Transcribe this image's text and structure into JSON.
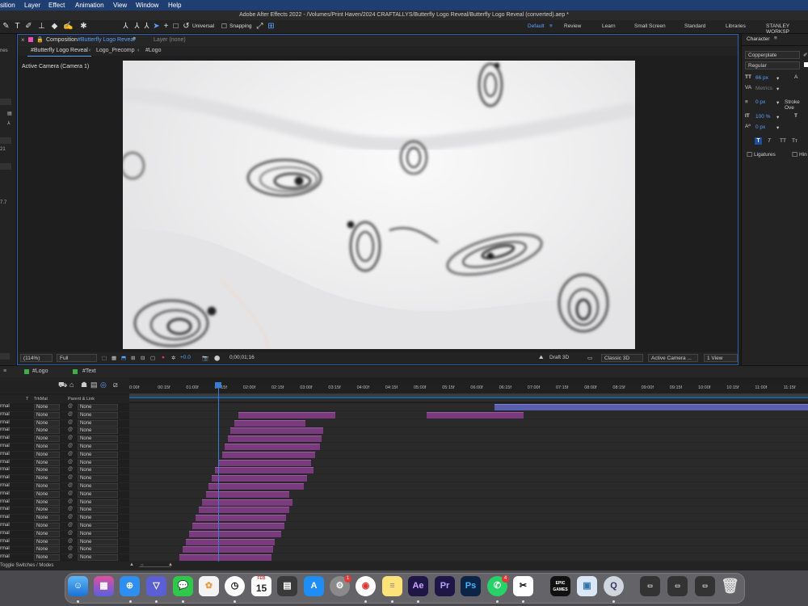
{
  "menubar": {
    "items": [
      "sition",
      "Layer",
      "Effect",
      "Animation",
      "View",
      "Window",
      "Help"
    ]
  },
  "app": {
    "title": "Adobe After Effects 2022 - /Volumes/Print Haven/2024 CRAFTALLYS/Butterfly Logo Reveal/Butterfly Logo Reveal (converted).aep *"
  },
  "toolbar": {
    "universal_label": "Universal",
    "snapping_label": "Snapping",
    "workspaces": [
      "Default",
      "Review",
      "Learn",
      "Small Screen",
      "Standard",
      "Libraries",
      "STANLEY WORKSP"
    ]
  },
  "left_strip": {
    "labels": [
      "nes",
      "21",
      "7.7"
    ]
  },
  "comp_panel": {
    "tab_label": "Composition",
    "comp_name": "#Butterfly Logo Reveal",
    "layer_tab": "Layer (none)",
    "breadcrumbs": [
      "#Butterfly Logo Reveal",
      "Logo_Precomp",
      "#Logo"
    ],
    "camera_label": "Active Camera (Camera 1)",
    "viewer_bar": {
      "zoom": "(114%)",
      "resolution": "Full",
      "exposure": "+0.0",
      "timecode": "0;00;01;16",
      "draft3d": "Draft 3D",
      "renderer": "Classic 3D",
      "camera": "Active Camera ...",
      "views": "1 View"
    }
  },
  "character_panel": {
    "title": "Character",
    "font_family": "Copperplate",
    "font_style": "Regular",
    "font_size": "66 px",
    "kerning": "Metrics",
    "stroke_width": "0 px",
    "stroke_type": "Stroke Ove",
    "vertical_scale": "100 %",
    "baseline_shift": "0 px",
    "ligatures_label": "Ligatures",
    "hindi_label": "Hin"
  },
  "timeline": {
    "tabs": [
      "#Logo",
      "#Text"
    ],
    "tab_colors": [
      "#3fae49",
      "#3fae49"
    ],
    "header": {
      "trkmat": "TrkMat",
      "parent": "Parent & Link",
      "t": "T"
    },
    "rows_count_visible": 20,
    "mode_value": "rmal",
    "trkmat_value": "None",
    "parent_value": "None",
    "ruler_ticks": [
      "0:00f",
      "00:15f",
      "01:00f",
      "01:15f",
      "02:00f",
      "02:15f",
      "03:00f",
      "03:15f",
      "04:00f",
      "04:15f",
      "05:00f",
      "05:15f",
      "06:00f",
      "06:15f",
      "07:00f",
      "07:15f",
      "08:00f",
      "08:15f",
      "09:00f",
      "09:15f",
      "10:00f",
      "10:15f",
      "11:00f",
      "11:15f"
    ],
    "toggle_label": "Toggle Switches / Modes",
    "bar_color": "#7a3a7e"
  },
  "dock": {
    "apps": [
      "Finder",
      "Launchpad",
      "Safari",
      "Notchmeister",
      "Messages",
      "Photos",
      "Clock",
      "Calendar",
      "Calculator",
      "App Store",
      "System Settings",
      "Chrome",
      "Notes",
      "After Effects",
      "Premiere Pro",
      "Photoshop",
      "WhatsApp",
      "CapCut",
      "Epic Games",
      "Preview",
      "QuickTime",
      "Trash"
    ],
    "calendar_month": "FEB",
    "calendar_day": "15",
    "ae_label": "Ae",
    "pr_label": "Pr",
    "ps_label": "Ps",
    "epic_label": "EPIC GAMES",
    "badge_settings": "1",
    "badge_whatsapp": "4"
  }
}
